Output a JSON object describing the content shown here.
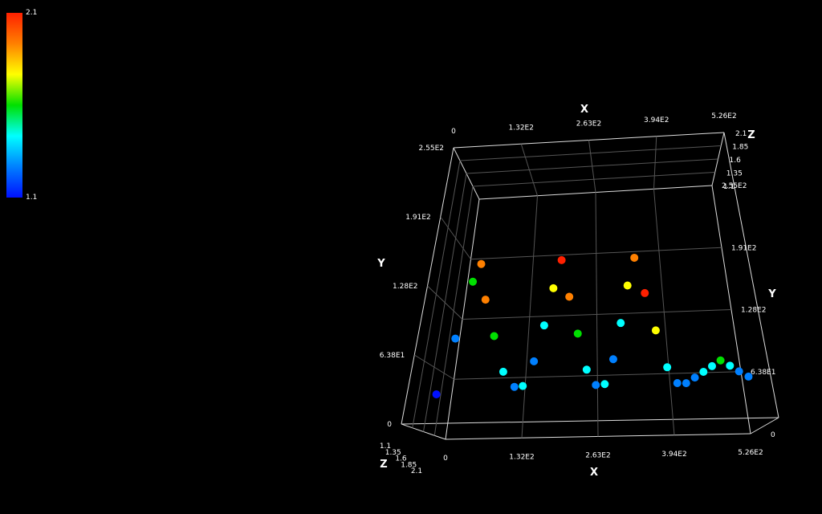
{
  "colorbar": {
    "max_label": "2.1",
    "min_label": "1.1",
    "stops": [
      "#ff2000",
      "#ff8000",
      "#ffff00",
      "#00e000",
      "#00ffff",
      "#0080ff",
      "#0010ff"
    ]
  },
  "chart_data": {
    "type": "scatter",
    "title": "",
    "xlabel": "X",
    "ylabel": "Y",
    "zlabel": "Z",
    "xlim": [
      0,
      526
    ],
    "ylim": [
      0,
      255
    ],
    "zlim": [
      1.1,
      2.1
    ],
    "x_ticks": [
      "0",
      "1.32E2",
      "2.63E2",
      "3.94E2",
      "5.26E2"
    ],
    "y_ticks": [
      "0",
      "6.38E1",
      "1.28E2",
      "1.91E2",
      "2.55E2"
    ],
    "z_ticks": [
      "1.1",
      "1.35",
      "1.6",
      "1.85",
      "2.1"
    ],
    "grid": true,
    "colormap": "jet",
    "series": [
      {
        "x": [
          0,
          20,
          40,
          55,
          70,
          90,
          110,
          130,
          145,
          160,
          175,
          190,
          205,
          220,
          235,
          250,
          265,
          280,
          295,
          310,
          325,
          340,
          355,
          370,
          385,
          400,
          415,
          430,
          445,
          460,
          475,
          490,
          505,
          520
        ],
        "y": [
          40,
          95,
          150,
          165,
          130,
          95,
          60,
          45,
          45,
          70,
          105,
          140,
          165,
          130,
          95,
          60,
          45,
          45,
          70,
          105,
          140,
          165,
          130,
          95,
          60,
          45,
          45,
          50,
          55,
          60,
          65,
          60,
          55,
          50
        ],
        "z": [
          1.1,
          1.3,
          1.6,
          2.0,
          1.9,
          1.6,
          1.4,
          1.3,
          1.5,
          1.3,
          1.4,
          1.7,
          2.1,
          1.9,
          1.6,
          1.4,
          1.3,
          1.5,
          1.3,
          1.4,
          1.7,
          2.0,
          2.1,
          1.8,
          1.5,
          1.3,
          1.2,
          1.3,
          1.4,
          1.5,
          1.6,
          1.5,
          1.3,
          1.2
        ]
      }
    ]
  }
}
